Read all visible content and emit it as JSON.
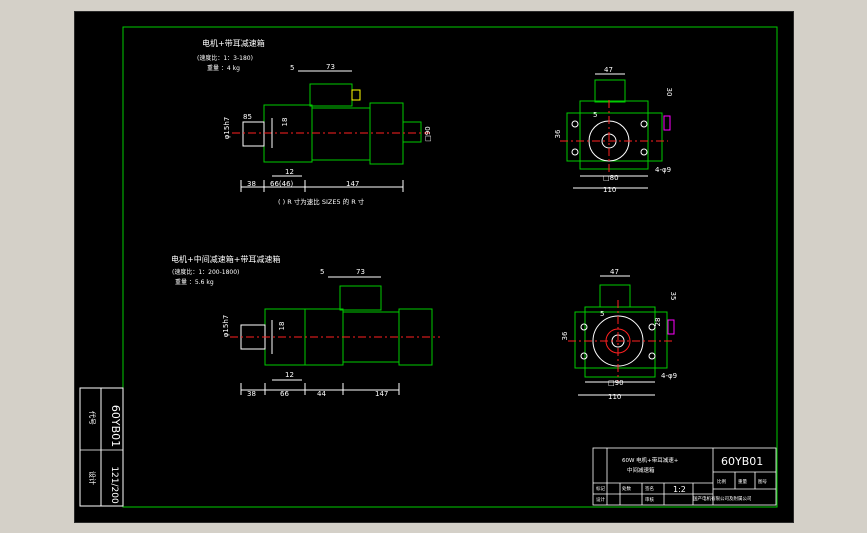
{
  "view1": {
    "title": "电机+带耳减速箱",
    "line2": "(速度比：1：3-180)",
    "line3": "重量 ：4 kg",
    "footnote": "( ) R 寸为速比 SIZE5 的 R 寸",
    "dims": {
      "d5": "5",
      "d73": "73",
      "d85": "85",
      "d15h7": "φ15h7",
      "d18": "18",
      "d12": "12",
      "d38": "38",
      "d66": "66(46)",
      "d147": "147",
      "d90": "□90"
    }
  },
  "view2": {
    "title": "电机+中间减速箱+带耳减速箱",
    "line2": "(速度比：1：200-1800)",
    "line3": "重量 ：5.6 kg",
    "dims": {
      "d5": "5",
      "d73": "73",
      "d15h7": "φ15h7",
      "d18": "18",
      "d12": "12",
      "d38": "38",
      "d66": "66",
      "d44": "44",
      "d147": "147"
    }
  },
  "side1": {
    "dims": {
      "d47": "47",
      "d30": "30",
      "d80": "□80",
      "d110": "110",
      "d36": "36",
      "holes": "4-φ9",
      "d5": "5"
    }
  },
  "side2": {
    "dims": {
      "d47": "47",
      "d35": "35",
      "d90": "□90",
      "d110": "110",
      "d36": "36",
      "holes": "4-φ9",
      "d5": "5",
      "d28": "28"
    }
  },
  "left_strip": {
    "code": "60YB01",
    "scale": "121/200",
    "label_a": "代号",
    "label_b": "设计"
  },
  "title_block": {
    "drawing_no": "60YB01",
    "name_line1": "60W 电机+带耳减速+",
    "name_line2": "中间减速箱",
    "scale": "1:2",
    "company": "国产电机有限公司及附属公司",
    "r1": "标记",
    "r2": "处数",
    "r3": "签名",
    "r4": "设计",
    "r5": "审核",
    "c1": "比例",
    "c2": "重量",
    "c3": "图号"
  },
  "colors": {
    "frame_green": "#00cc00",
    "white": "#ffffff",
    "red": "#ff2020",
    "yellow": "#ffff00",
    "magenta": "#ff00ff",
    "background": "#000000"
  }
}
